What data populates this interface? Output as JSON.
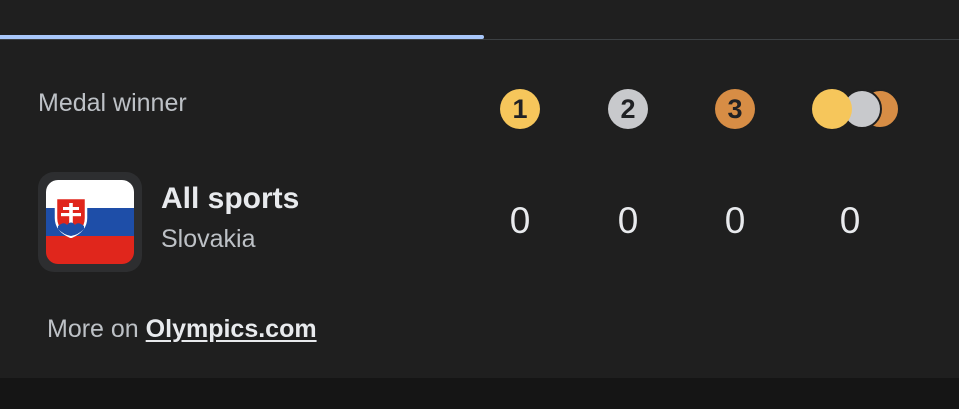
{
  "header": {
    "label": "Medal winner"
  },
  "medals": {
    "gold": "1",
    "silver": "2",
    "bronze": "3"
  },
  "row": {
    "sport": "All sports",
    "country": "Slovakia",
    "counts": [
      "0",
      "0",
      "0",
      "0"
    ]
  },
  "footer": {
    "prefix": "More on ",
    "link": "Olympics.com"
  },
  "colors": {
    "gold": "#f6c65b",
    "silver": "#c8c9cc",
    "bronze": "#d78d45",
    "tab_indicator": "#a8c7fa"
  },
  "icons": [
    "gold-medal-icon",
    "silver-medal-icon",
    "bronze-medal-icon",
    "total-medals-icon",
    "slovakia-flag-icon"
  ]
}
